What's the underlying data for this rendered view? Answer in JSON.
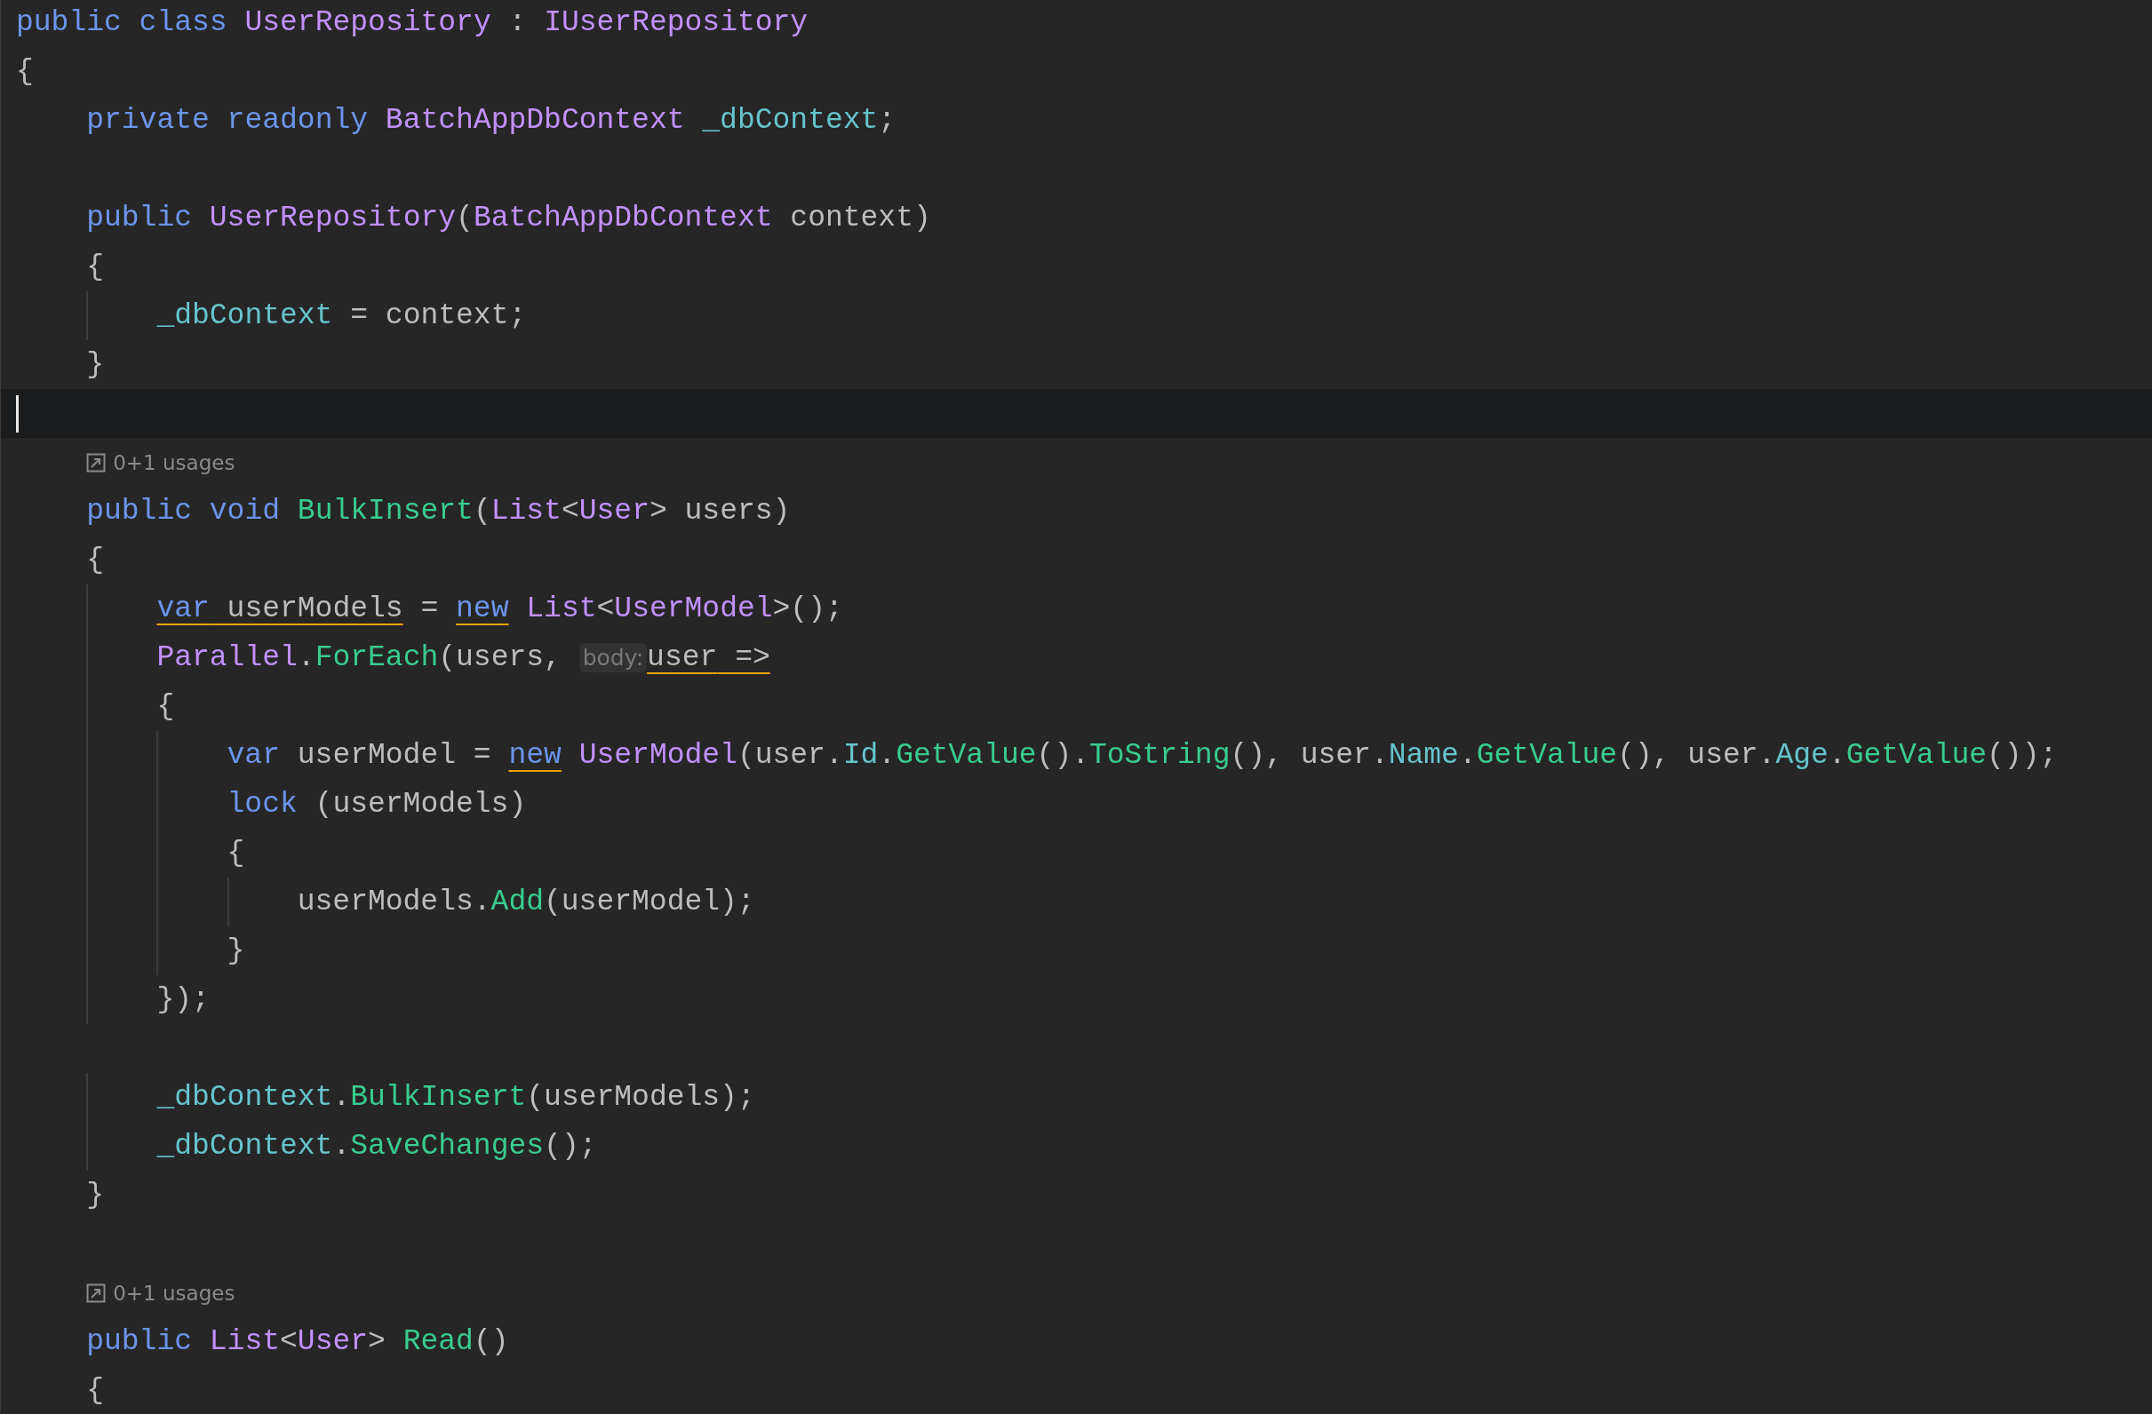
{
  "editor": {
    "lines": [
      {
        "kind": "code",
        "current": false,
        "tokens": [
          {
            "text": "public class ",
            "kind": "keyword",
            "underlined": false
          },
          {
            "text": "UserRepository",
            "kind": "type",
            "underlined": false
          },
          {
            "text": " : ",
            "kind": "plain",
            "underlined": false
          },
          {
            "text": "IUserRepository",
            "kind": "type",
            "underlined": false
          }
        ]
      },
      {
        "kind": "code",
        "current": false,
        "tokens": [
          {
            "text": "{",
            "kind": "plain",
            "underlined": false
          }
        ],
        "children": [
          {
            "kind": "code",
            "current": false,
            "tokens": [
              {
                "text": "private readonly ",
                "kind": "keyword",
                "underlined": false
              },
              {
                "text": "BatchAppDbContext ",
                "kind": "type",
                "underlined": false
              },
              {
                "text": "_dbContext",
                "kind": "field",
                "underlined": false
              },
              {
                "text": ";",
                "kind": "plain",
                "underlined": false
              }
            ]
          },
          {
            "kind": "blank",
            "current": false
          },
          {
            "kind": "code",
            "current": false,
            "tokens": [
              {
                "text": "public ",
                "kind": "keyword",
                "underlined": false
              },
              {
                "text": "UserRepository",
                "kind": "type",
                "underlined": false
              },
              {
                "text": "(",
                "kind": "plain",
                "underlined": false
              },
              {
                "text": "BatchAppDbContext",
                "kind": "type",
                "underlined": false
              },
              {
                "text": " context)",
                "kind": "plain",
                "underlined": false
              }
            ]
          },
          {
            "kind": "code",
            "current": false,
            "tokens": [
              {
                "text": "{",
                "kind": "plain",
                "underlined": false
              }
            ],
            "children": [
              {
                "kind": "code",
                "current": false,
                "tokens": [
                  {
                    "text": "_dbContext",
                    "kind": "field",
                    "underlined": false
                  },
                  {
                    "text": " = context;",
                    "kind": "plain",
                    "underlined": false
                  }
                ]
              }
            ]
          },
          {
            "kind": "code",
            "current": false,
            "tokens": [
              {
                "text": "}",
                "kind": "plain",
                "underlined": false
              }
            ]
          },
          {
            "kind": "blank",
            "current": true
          },
          {
            "kind": "usages",
            "current": false,
            "text": "0+1 usages"
          },
          {
            "kind": "code",
            "current": false,
            "tokens": [
              {
                "text": "public void ",
                "kind": "keyword",
                "underlined": false
              },
              {
                "text": "BulkInsert",
                "kind": "method",
                "underlined": false
              },
              {
                "text": "(",
                "kind": "plain",
                "underlined": false
              },
              {
                "text": "List",
                "kind": "type",
                "underlined": false
              },
              {
                "text": "<",
                "kind": "plain",
                "underlined": false
              },
              {
                "text": "User",
                "kind": "type",
                "underlined": false
              },
              {
                "text": "> users)",
                "kind": "plain",
                "underlined": false
              }
            ]
          },
          {
            "kind": "code",
            "current": false,
            "tokens": [
              {
                "text": "{",
                "kind": "plain",
                "underlined": false
              }
            ],
            "children": [
              {
                "kind": "code",
                "current": false,
                "tokens": [
                  {
                    "text": "var",
                    "kind": "keyword",
                    "underlined": true
                  },
                  {
                    "text": " userModels",
                    "kind": "plain",
                    "underlined": true
                  },
                  {
                    "text": " = ",
                    "kind": "plain",
                    "underlined": false
                  },
                  {
                    "text": "new",
                    "kind": "keyword",
                    "underlined": true
                  },
                  {
                    "text": " List",
                    "kind": "type",
                    "underlined": false
                  },
                  {
                    "text": "<",
                    "kind": "plain",
                    "underlined": false
                  },
                  {
                    "text": "UserModel",
                    "kind": "type",
                    "underlined": false
                  },
                  {
                    "text": ">();",
                    "kind": "plain",
                    "underlined": false
                  }
                ]
              },
              {
                "kind": "code",
                "current": false,
                "tokens": [
                  {
                    "text": "Parallel",
                    "kind": "type",
                    "underlined": false
                  },
                  {
                    "text": ".",
                    "kind": "plain",
                    "underlined": false
                  },
                  {
                    "text": "ForEach",
                    "kind": "method",
                    "underlined": false
                  },
                  {
                    "text": "(users,",
                    "kind": "plain",
                    "underlined": false
                  },
                  {
                    "text": "body:",
                    "kind": "inlay",
                    "underlined": false
                  },
                  {
                    "text": "user",
                    "kind": "plain",
                    "underlined": true
                  },
                  {
                    "text": " =>",
                    "kind": "plain",
                    "underlined": true
                  }
                ]
              },
              {
                "kind": "code",
                "current": false,
                "tokens": [
                  {
                    "text": "{",
                    "kind": "plain",
                    "underlined": false
                  }
                ],
                "children": [
                  {
                    "kind": "code",
                    "current": false,
                    "tokens": [
                      {
                        "text": "var",
                        "kind": "keyword",
                        "underlined": false
                      },
                      {
                        "text": " userModel = ",
                        "kind": "plain",
                        "underlined": false
                      },
                      {
                        "text": "new",
                        "kind": "keyword",
                        "underlined": true
                      },
                      {
                        "text": " UserModel",
                        "kind": "type",
                        "underlined": false
                      },
                      {
                        "text": "(user.",
                        "kind": "plain",
                        "underlined": false
                      },
                      {
                        "text": "Id",
                        "kind": "field",
                        "underlined": false
                      },
                      {
                        "text": ".",
                        "kind": "plain",
                        "underlined": false
                      },
                      {
                        "text": "GetValue",
                        "kind": "method",
                        "underlined": false
                      },
                      {
                        "text": "().",
                        "kind": "plain",
                        "underlined": false
                      },
                      {
                        "text": "ToString",
                        "kind": "method",
                        "underlined": false
                      },
                      {
                        "text": "(), user.",
                        "kind": "plain",
                        "underlined": false
                      },
                      {
                        "text": "Name",
                        "kind": "field",
                        "underlined": false
                      },
                      {
                        "text": ".",
                        "kind": "plain",
                        "underlined": false
                      },
                      {
                        "text": "GetValue",
                        "kind": "method",
                        "underlined": false
                      },
                      {
                        "text": "(), user.",
                        "kind": "plain",
                        "underlined": false
                      },
                      {
                        "text": "Age",
                        "kind": "field",
                        "underlined": false
                      },
                      {
                        "text": ".",
                        "kind": "plain",
                        "underlined": false
                      },
                      {
                        "text": "GetValue",
                        "kind": "method",
                        "underlined": false
                      },
                      {
                        "text": "());",
                        "kind": "plain",
                        "underlined": false
                      }
                    ]
                  },
                  {
                    "kind": "code",
                    "current": false,
                    "tokens": [
                      {
                        "text": "lock",
                        "kind": "keyword",
                        "underlined": false
                      },
                      {
                        "text": " (userModels)",
                        "kind": "plain",
                        "underlined": false
                      }
                    ]
                  },
                  {
                    "kind": "code",
                    "current": false,
                    "tokens": [
                      {
                        "text": "{",
                        "kind": "plain",
                        "underlined": false
                      }
                    ],
                    "children": [
                      {
                        "kind": "code",
                        "current": false,
                        "tokens": [
                          {
                            "text": "userModels.",
                            "kind": "plain",
                            "underlined": false
                          },
                          {
                            "text": "Add",
                            "kind": "method",
                            "underlined": false
                          },
                          {
                            "text": "(userModel);",
                            "kind": "plain",
                            "underlined": false
                          }
                        ]
                      }
                    ]
                  },
                  {
                    "kind": "code",
                    "current": false,
                    "tokens": [
                      {
                        "text": "}",
                        "kind": "plain",
                        "underlined": false
                      }
                    ]
                  }
                ]
              },
              {
                "kind": "code",
                "current": false,
                "tokens": [
                  {
                    "text": "});",
                    "kind": "plain",
                    "underlined": false
                  }
                ]
              },
              {
                "kind": "blank",
                "current": false
              },
              {
                "kind": "code",
                "current": false,
                "tokens": [
                  {
                    "text": "_dbContext",
                    "kind": "field",
                    "underlined": false
                  },
                  {
                    "text": ".",
                    "kind": "plain",
                    "underlined": false
                  },
                  {
                    "text": "BulkInsert",
                    "kind": "method",
                    "underlined": false
                  },
                  {
                    "text": "(userModels);",
                    "kind": "plain",
                    "underlined": false
                  }
                ]
              },
              {
                "kind": "code",
                "current": false,
                "tokens": [
                  {
                    "text": "_dbContext",
                    "kind": "field",
                    "underlined": false
                  },
                  {
                    "text": ".",
                    "kind": "plain",
                    "underlined": false
                  },
                  {
                    "text": "SaveChanges",
                    "kind": "method",
                    "underlined": false
                  },
                  {
                    "text": "();",
                    "kind": "plain",
                    "underlined": false
                  }
                ]
              }
            ]
          },
          {
            "kind": "code",
            "current": false,
            "tokens": [
              {
                "text": "}",
                "kind": "plain",
                "underlined": false
              }
            ]
          },
          {
            "kind": "blank",
            "current": false
          },
          {
            "kind": "usages",
            "current": false,
            "text": "0+1 usages"
          },
          {
            "kind": "code",
            "current": false,
            "tokens": [
              {
                "text": "public ",
                "kind": "keyword",
                "underlined": false
              },
              {
                "text": "List",
                "kind": "type",
                "underlined": false
              },
              {
                "text": "<",
                "kind": "plain",
                "underlined": false
              },
              {
                "text": "User",
                "kind": "type",
                "underlined": false
              },
              {
                "text": "> ",
                "kind": "plain",
                "underlined": false
              },
              {
                "text": "Read",
                "kind": "method",
                "underlined": false
              },
              {
                "text": "()",
                "kind": "plain",
                "underlined": false
              }
            ]
          },
          {
            "kind": "code",
            "current": false,
            "tokens": [
              {
                "text": "{",
                "kind": "plain",
                "underlined": false
              }
            ]
          }
        ]
      }
    ]
  }
}
